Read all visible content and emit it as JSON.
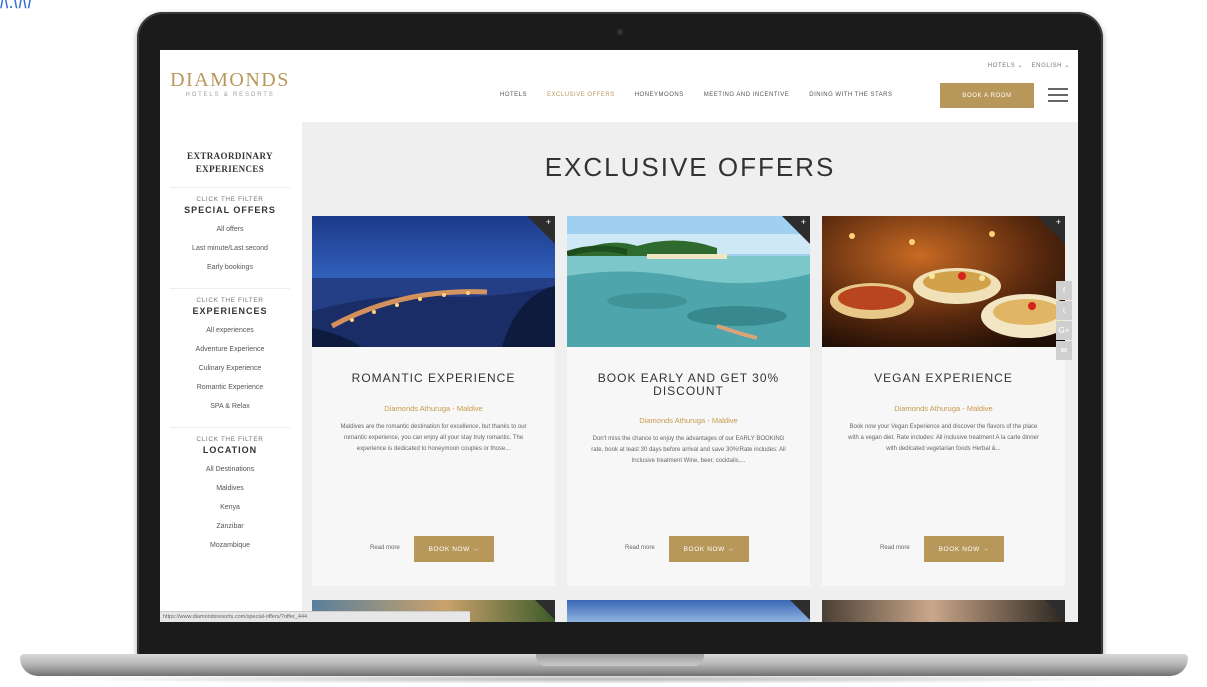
{
  "brand": {
    "name": "DIAMONDS",
    "tagline": "HOTELS & RESORTS"
  },
  "top_util": {
    "hotels": "HOTELS ⌄",
    "language": "ENGLISH ⌄"
  },
  "nav": {
    "items": [
      "HOTELS",
      "EXCLUSIVE OFFERS",
      "HONEYMOONS",
      "MEETING AND INCENTIVE",
      "DINING WITH THE STARS"
    ],
    "active": "EXCLUSIVE OFFERS",
    "book_room": "BOOK A ROOM"
  },
  "sidebar": {
    "title": "EXTRAORDINARY EXPERIENCES",
    "groups": [
      {
        "hint": "CLICK THE FILTER",
        "heading": "SPECIAL OFFERS",
        "links": [
          "All offers",
          "Last minute/Last second",
          "Early bookings"
        ]
      },
      {
        "hint": "CLICK THE FILTER",
        "heading": "EXPERIENCES",
        "links": [
          "All experiences",
          "Adventure Experience",
          "Culinary Experience",
          "Romantic Experience",
          "SPA & Relax"
        ]
      },
      {
        "hint": "CLICK THE FILTER",
        "heading": "LOCATION",
        "links": [
          "All Destinations",
          "Maldives",
          "Kenya",
          "Zanzibar",
          "Mozambique"
        ]
      }
    ]
  },
  "main": {
    "title": "EXCLUSIVE OFFERS",
    "cards": [
      {
        "image": "night-beach-dinner",
        "title": "ROMANTIC EXPERIENCE",
        "location": "Diamonds Athuruga - Maldive",
        "description": "Maldives are the romantic destination for excellence, but thanks to our romantic experience, you can enjoy all your stay truly romantic. The experience is dedicated to honeymoon couples or those...",
        "read_more": "Read more",
        "button": "BOOK NOW →"
      },
      {
        "image": "lagoon-snorkel",
        "title": "BOOK EARLY AND GET 30% DISCOUNT",
        "location": "Diamonds Athuruga - Maldive",
        "description": "Don't miss the chance to enjoy the advantages of our EARLY BOOKING rate, book at least 30 days before arrival and save 30%!Rate includes: All Inclusive treatment Wine, beer, cocktails,...",
        "read_more": "Read more",
        "button": "BOOK NOW →"
      },
      {
        "image": "vegan-dishes",
        "title": "VEGAN EXPERIENCE",
        "location": "Diamonds Athuruga - Maldive",
        "description": "Book now your Vegan Experience and discover the flavors of the place with a vegan diet. Rate includes: All inclusive treatment A la carte dinner with dedicated vegetarian foods Herbal &...",
        "read_more": "Read more",
        "button": "BOOK NOW →"
      }
    ]
  },
  "social": [
    "f",
    "t",
    "G+",
    "✉"
  ],
  "status_url": "https://www.diamondsresorts.com/special-offers/?offer_444"
}
